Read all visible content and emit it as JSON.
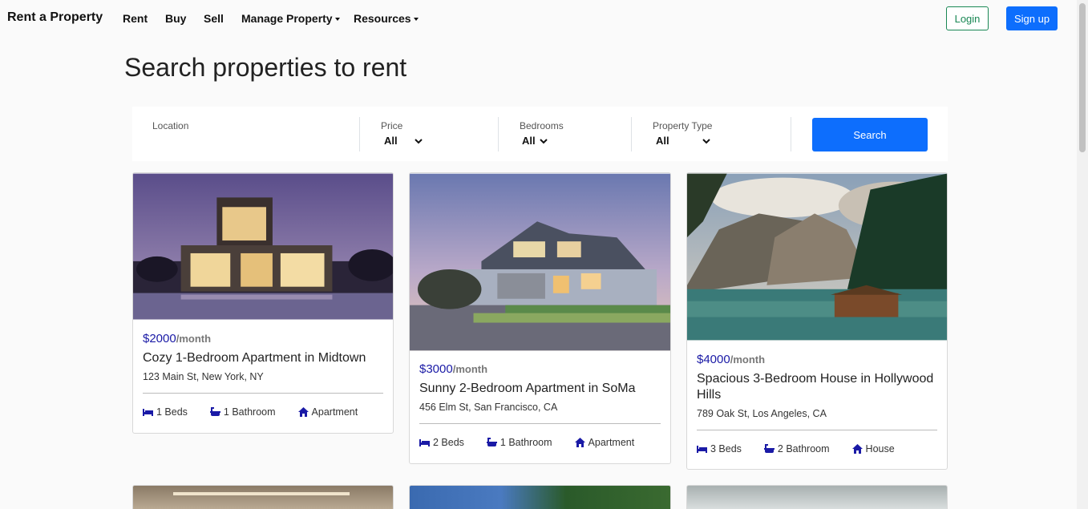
{
  "nav": {
    "brand": "Rent a Property",
    "links": [
      "Rent",
      "Buy",
      "Sell",
      "Manage Property",
      "Resources"
    ],
    "login": "Login",
    "signup": "Sign up"
  },
  "page_title": "Search properties to rent",
  "search": {
    "location_label": "Location",
    "price_label": "Price",
    "price_value": "All",
    "bedrooms_label": "Bedrooms",
    "bedrooms_value": "All",
    "type_label": "Property Type",
    "type_value": "All",
    "button": "Search"
  },
  "listings": [
    {
      "price": "$2000",
      "per": "/month",
      "title": "Cozy 1-Bedroom Apartment in Midtown",
      "address": "123 Main St, New York, NY",
      "beds": "1 Beds",
      "baths": "1 Bathroom",
      "type": "Apartment"
    },
    {
      "price": "$3000",
      "per": "/month",
      "title": "Sunny 2-Bedroom Apartment in SoMa",
      "address": "456 Elm St, San Francisco, CA",
      "beds": "2 Beds",
      "baths": "1 Bathroom",
      "type": "Apartment"
    },
    {
      "price": "$4000",
      "per": "/month",
      "title": "Spacious 3-Bedroom House in Hollywood Hills",
      "address": "789 Oak St, Los Angeles, CA",
      "beds": "3 Beds",
      "baths": "2 Bathroom",
      "type": "House"
    }
  ],
  "colors": {
    "primary": "#0d6efd",
    "success": "#198754",
    "price": "#1a1aa6"
  }
}
